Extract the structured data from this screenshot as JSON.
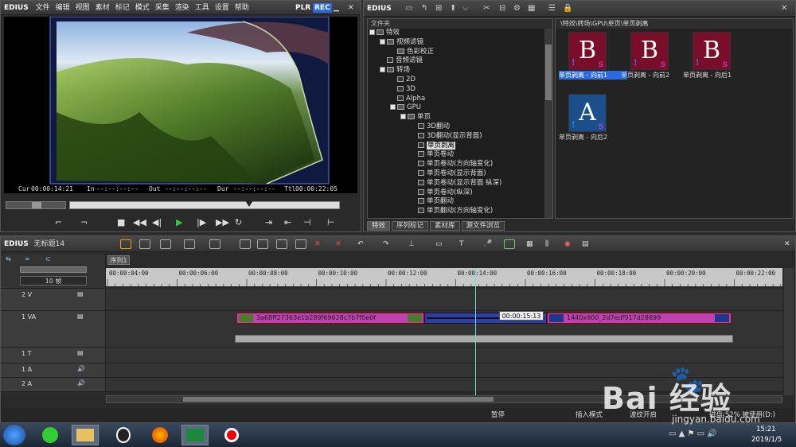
{
  "player": {
    "app": "EDIUS",
    "menu": [
      "文件",
      "编辑",
      "视图",
      "素材",
      "标记",
      "模式",
      "采集",
      "渲染",
      "工具",
      "设置",
      "帮助"
    ],
    "plr": "PLR",
    "rec": "REC",
    "cur_label": "Cur",
    "cur": "00:00:14:21",
    "in_label": "In",
    "in": "--:--:--:--",
    "out_label": "Out",
    "out": "--:--:--:--",
    "dur_label": "Dur",
    "dur": "--:--:--:--",
    "ttl_label": "Ttl",
    "ttl": "00:00:22:05"
  },
  "effects": {
    "app": "EDIUS",
    "folder_header": "文件夹",
    "path": "\\特效\\转场\\GPU\\单页\\单页剥离",
    "tree": [
      {
        "label": "特效",
        "indent": 0,
        "kind": "folder",
        "exp": "−"
      },
      {
        "label": "视频滤镜",
        "indent": 1,
        "kind": "folder",
        "exp": "+"
      },
      {
        "label": "色彩校正",
        "indent": 2,
        "kind": "folder",
        "exp": ""
      },
      {
        "label": "音频滤镜",
        "indent": 1,
        "kind": "eff",
        "exp": ""
      },
      {
        "label": "转场",
        "indent": 1,
        "kind": "folder",
        "exp": "−"
      },
      {
        "label": "2D",
        "indent": 2,
        "kind": "eff",
        "exp": ""
      },
      {
        "label": "3D",
        "indent": 2,
        "kind": "eff",
        "exp": ""
      },
      {
        "label": "Alpha",
        "indent": 2,
        "kind": "eff",
        "exp": ""
      },
      {
        "label": "GPU",
        "indent": 2,
        "kind": "folder",
        "exp": "−"
      },
      {
        "label": "单页",
        "indent": 3,
        "kind": "folder",
        "exp": "−"
      },
      {
        "label": "3D翻动",
        "indent": 4,
        "kind": "eff",
        "exp": ""
      },
      {
        "label": "3D翻动(显示背面)",
        "indent": 4,
        "kind": "eff",
        "exp": ""
      },
      {
        "label": "单页剥离",
        "indent": 4,
        "kind": "eff",
        "exp": "",
        "selected": true
      },
      {
        "label": "单页卷动",
        "indent": 4,
        "kind": "eff",
        "exp": ""
      },
      {
        "label": "单页卷动(方向轴变化)",
        "indent": 4,
        "kind": "eff",
        "exp": ""
      },
      {
        "label": "单页卷动(显示背面)",
        "indent": 4,
        "kind": "eff",
        "exp": ""
      },
      {
        "label": "单页卷动(显示背面 纵深)",
        "indent": 4,
        "kind": "eff",
        "exp": ""
      },
      {
        "label": "单页卷动(纵深)",
        "indent": 4,
        "kind": "eff",
        "exp": ""
      },
      {
        "label": "单页翻动",
        "indent": 4,
        "kind": "eff",
        "exp": ""
      },
      {
        "label": "单页翻动(方向轴变化)",
        "indent": 4,
        "kind": "eff",
        "exp": ""
      }
    ],
    "items": [
      {
        "letter": "B",
        "label": "单页剥离 - 向前1",
        "selected": true
      },
      {
        "letter": "B",
        "label": "单页剥离 - 向前2"
      },
      {
        "letter": "B",
        "label": "单页剥离 - 向后1"
      },
      {
        "letter": "A",
        "label": "单页剥离 - 向后2",
        "blue": true
      }
    ],
    "tabs": [
      "特效",
      "序列标记",
      "素材库",
      "源文件浏览"
    ]
  },
  "timeline": {
    "app": "EDIUS",
    "project": "无标题14",
    "sequence_tab": "序列1",
    "zoom": "10 帧",
    "ruler": [
      "00:00:04:00",
      "00:00:06:00",
      "00:00:08:00",
      "00:00:10:00",
      "00:00:12:00",
      "00:00:14:00",
      "00:00:16:00",
      "00:00:18:00",
      "00:00:20:00",
      "00:00:22:00"
    ],
    "tracks": [
      "2 V",
      "1 VA",
      "1 T",
      "1 A",
      "2 A"
    ],
    "clip1": "3a68ff27363e1b289f69628c7b7f0e0f",
    "clip2": "1440x900_2d7edf917d28899",
    "tooltip": "00:00:15:13",
    "status": {
      "mode1": "暂停",
      "mode2": "插入模式",
      "mode3": "波纹开启",
      "disk": "磁盘:52% 被使用(D:)"
    }
  },
  "taskbar": {
    "time": "15:21",
    "date": "2019/1/5"
  },
  "watermark": {
    "brand": "Bai 经验",
    "url": "jingyan.baidu.com"
  }
}
